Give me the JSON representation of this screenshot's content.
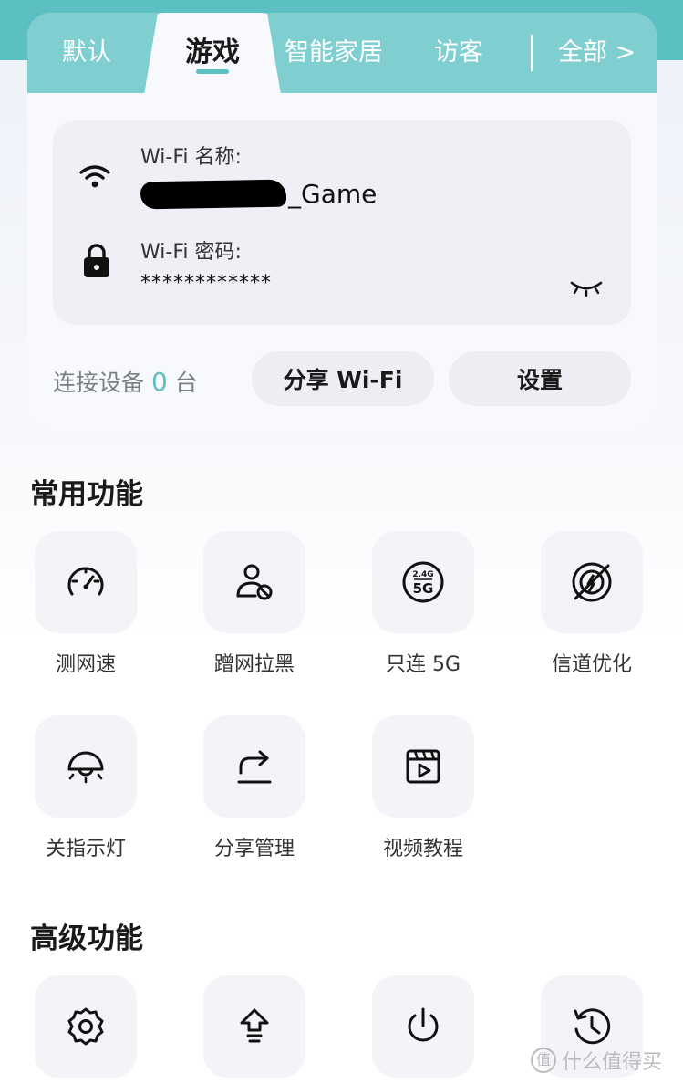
{
  "tabs": {
    "default": "默认",
    "game": "游戏",
    "smart_home": "智能家居",
    "guest": "访客",
    "all": "全部 >"
  },
  "wifi": {
    "name_label": "Wi-Fi 名称:",
    "name_suffix": "_Game",
    "password_label": "Wi-Fi 密码:",
    "password_value": "************"
  },
  "devices": {
    "prefix": "连接设备",
    "count": "0",
    "unit": "台"
  },
  "buttons": {
    "share_wifi": "分享 Wi-Fi",
    "settings": "设置"
  },
  "common": {
    "title": "常用功能",
    "items": [
      {
        "label": "测网速",
        "icon": "speedometer-icon"
      },
      {
        "label": "蹭网拉黑",
        "icon": "user-block-icon"
      },
      {
        "label": "只连 5G",
        "icon": "5g-only-icon"
      },
      {
        "label": "信道优化",
        "icon": "signal-optimize-icon"
      },
      {
        "label": "关指示灯",
        "icon": "indicator-light-icon"
      },
      {
        "label": "分享管理",
        "icon": "share-arrow-icon"
      },
      {
        "label": "视频教程",
        "icon": "video-tutorial-icon"
      }
    ]
  },
  "advanced": {
    "title": "高级功能",
    "items": [
      {
        "icon": "gear-icon"
      },
      {
        "icon": "upgrade-icon"
      },
      {
        "icon": "power-icon"
      },
      {
        "icon": "history-icon"
      }
    ]
  },
  "watermark": {
    "logo": "值",
    "text": "什么值得买"
  },
  "colors": {
    "accent": "#5cbfc1",
    "tab_bar": "#7fcfd1",
    "tile": "#f3f4f8"
  }
}
